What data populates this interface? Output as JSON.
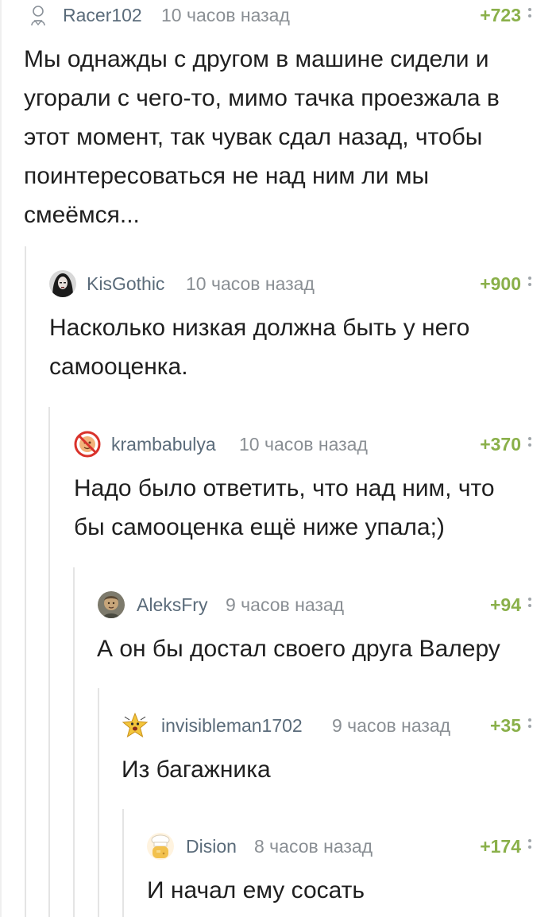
{
  "comments": [
    {
      "username": "Racer102",
      "time": "10 часов назад",
      "rating": "+723",
      "avatar_icon": "outline-person-icon",
      "text": "Мы однажды с другом в машине сидели и угорали с чего-то, мимо тачка проезжала в этот момент, так чувак сдал назад, чтобы поинтересоваться не над ним ли мы смеёмся..."
    },
    {
      "username": "KisGothic",
      "time": "10 часов назад",
      "rating": "+900",
      "avatar_icon": "gothic-girl-avatar",
      "text": "Насколько низкая должна быть у него самооценка."
    },
    {
      "username": "krambabulya",
      "time": "10 часов назад",
      "rating": "+370",
      "avatar_icon": "no-sign-avatar",
      "text": "Надо было ответить, что над ним, что бы самооценка ещё ниже упала;)"
    },
    {
      "username": "AleksFry",
      "time": "9 часов назад",
      "rating": "+94",
      "avatar_icon": "portrait-avatar",
      "text": "А он бы достал своего друга Валеру"
    },
    {
      "username": "invisibleman1702",
      "time": "9 часов назад",
      "rating": "+35",
      "avatar_icon": "star-face-avatar",
      "text": "Из багажника"
    },
    {
      "username": "Dision",
      "time": "8 часов назад",
      "rating": "+174",
      "avatar_icon": "chef-avatar",
      "text": "И начал ему сосать"
    }
  ],
  "colors": {
    "username": "#5a6b7a",
    "time": "#8a8f94",
    "rating": "#8ab04a",
    "thread_line": "#e4e4e4"
  }
}
